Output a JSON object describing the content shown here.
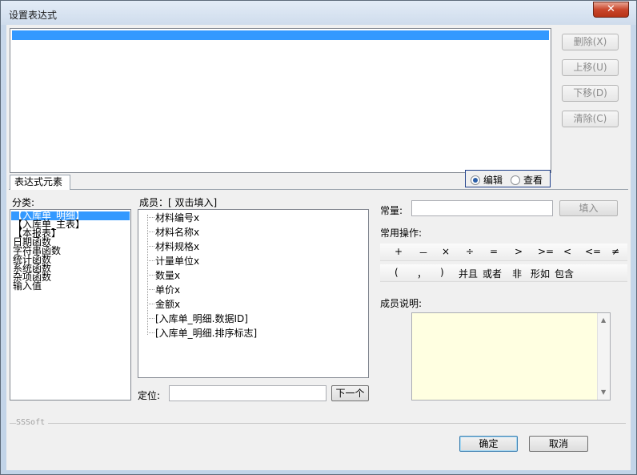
{
  "window": {
    "title": "设置表达式",
    "close_label": "✕"
  },
  "side_buttons": [
    {
      "label": "删除(X)"
    },
    {
      "label": "上移(U)"
    },
    {
      "label": "下移(D)"
    },
    {
      "label": "清除(C)"
    }
  ],
  "tab": {
    "label": "表达式元素"
  },
  "mode": {
    "edit_label": "编辑",
    "view_label": "查看",
    "selected": "编辑"
  },
  "category": {
    "label": "分类:",
    "items": [
      "【入库单_明细】",
      "【入库单_主表】",
      "【本报表】",
      "日期函数",
      "字符串函数",
      "统计函数",
      "系统函数",
      "杂项函数",
      "输入值"
    ],
    "selected_index": 0
  },
  "members": {
    "label": "成员：[ 双击填入]",
    "items": [
      "材料编号x",
      "材料名称x",
      "材料规格x",
      "计量单位x",
      "数量x",
      "单价x",
      "金额x",
      "[入库单_明细.数据ID]",
      "[入库单_明细.排序标志]"
    ]
  },
  "locate": {
    "label": "定位:",
    "value": "",
    "next_label": "下一个"
  },
  "constant": {
    "label": "常量:",
    "value": "",
    "fill_label": "填入"
  },
  "operators": {
    "label": "常用操作:",
    "row1": [
      "+",
      "－",
      "×",
      "÷",
      "=",
      ">",
      ">=",
      "<",
      "<=",
      "≠"
    ],
    "row2": [
      "(",
      "，",
      ")",
      "并且",
      "或者",
      "非",
      "形如",
      "包含"
    ]
  },
  "description": {
    "label": "成员说明:",
    "text": ""
  },
  "footer": {
    "brand": "SSSoft",
    "ok_label": "确定",
    "cancel_label": "取消"
  }
}
